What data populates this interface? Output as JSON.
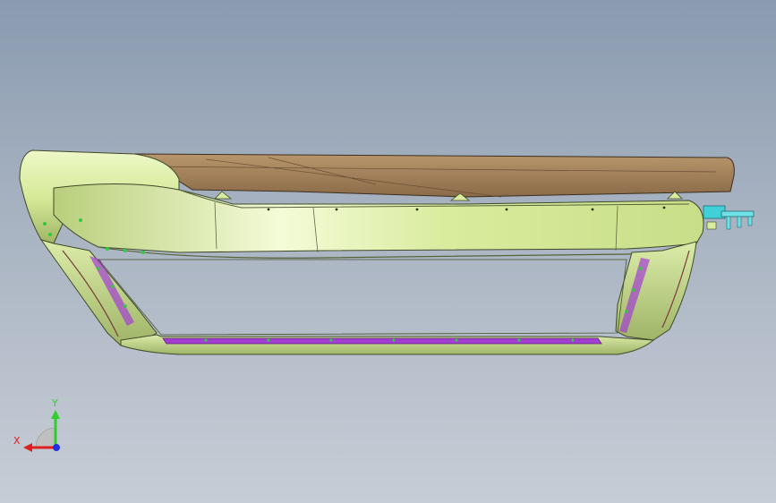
{
  "viewport": {
    "background_top": "#8a9bb0",
    "background_bottom": "#c7cdd6"
  },
  "model": {
    "name_icon": "cad-sunroof-frame-assembly",
    "colors": {
      "frame_green": "#d8ec9e",
      "frame_dark": "#a8bf6a",
      "frame_edge": "#3f4a2a",
      "glass_brown": "#9c7a55",
      "seal_purple": "#a23fd0",
      "clip_cyan": "#3fd0d8",
      "clip_green": "#2ecc40"
    }
  },
  "triad": {
    "x_label": "X",
    "y_label": "Y",
    "x_color": "#e02020",
    "y_color": "#2ccf2c",
    "z_color": "#2030e0"
  }
}
